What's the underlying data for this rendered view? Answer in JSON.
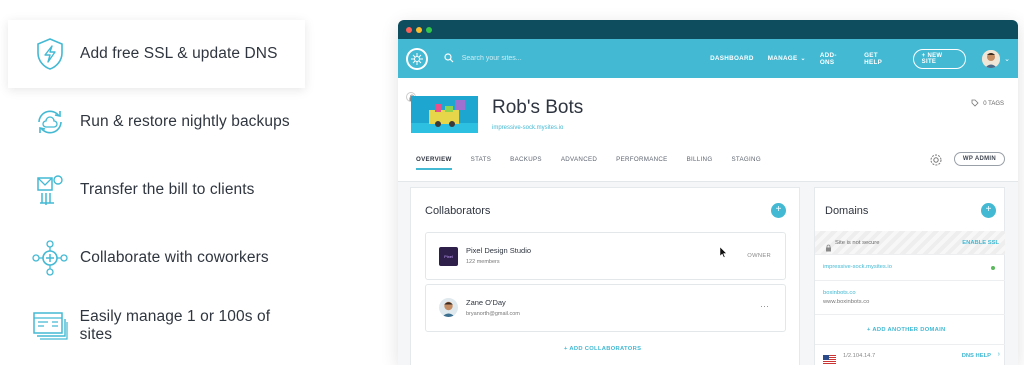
{
  "features": [
    {
      "label": "Add free SSL & update DNS",
      "icon": "shield-bolt-icon"
    },
    {
      "label": "Run & restore nightly backups",
      "icon": "backup-cycle-icon"
    },
    {
      "label": "Transfer the bill to clients",
      "icon": "transfer-bill-icon"
    },
    {
      "label": "Collaborate with coworkers",
      "icon": "collaborate-icon"
    },
    {
      "label": "Easily manage 1 or 100s of sites",
      "icon": "manage-sites-icon"
    }
  ],
  "app": {
    "search_placeholder": "Search your sites...",
    "nav": {
      "dashboard": "DASHBOARD",
      "manage": "MANAGE",
      "addons": "ADD-ONS",
      "help": "GET HELP",
      "new_site": "+ NEW SITE"
    },
    "colors": {
      "accent": "#43b9d3",
      "titlebar": "#0d4d5e"
    }
  },
  "site": {
    "title": "Rob's Bots",
    "url": "impressive-sock.mysites.io",
    "tags": "0 TAGS",
    "tabs": [
      "OVERVIEW",
      "STATS",
      "BACKUPS",
      "ADVANCED",
      "PERFORMANCE",
      "BILLING",
      "STAGING"
    ],
    "wp_admin": "WP ADMIN"
  },
  "collaborators": {
    "title": "Collaborators",
    "items": [
      {
        "name": "Pixel Design Studio",
        "sub": "122 members",
        "role": "OWNER",
        "logo_text": "Pixel"
      },
      {
        "name": "Zane O'Day",
        "sub": "bryanorth@gmail.com",
        "menu": "···"
      }
    ],
    "add_label": "+ ADD COLLABORATORS"
  },
  "domains": {
    "title": "Domains",
    "not_secure": "Site is not secure",
    "enable_ssl": "ENABLE SSL",
    "primary": "impressive-sock.mysites.io",
    "secondary_name": "boxinbots.co",
    "secondary_url": "www.boxinbots.co",
    "add_label": "+ ADD ANOTHER DOMAIN",
    "ip": "1/2.104.14.7",
    "dns_help": "DNS HELP"
  }
}
